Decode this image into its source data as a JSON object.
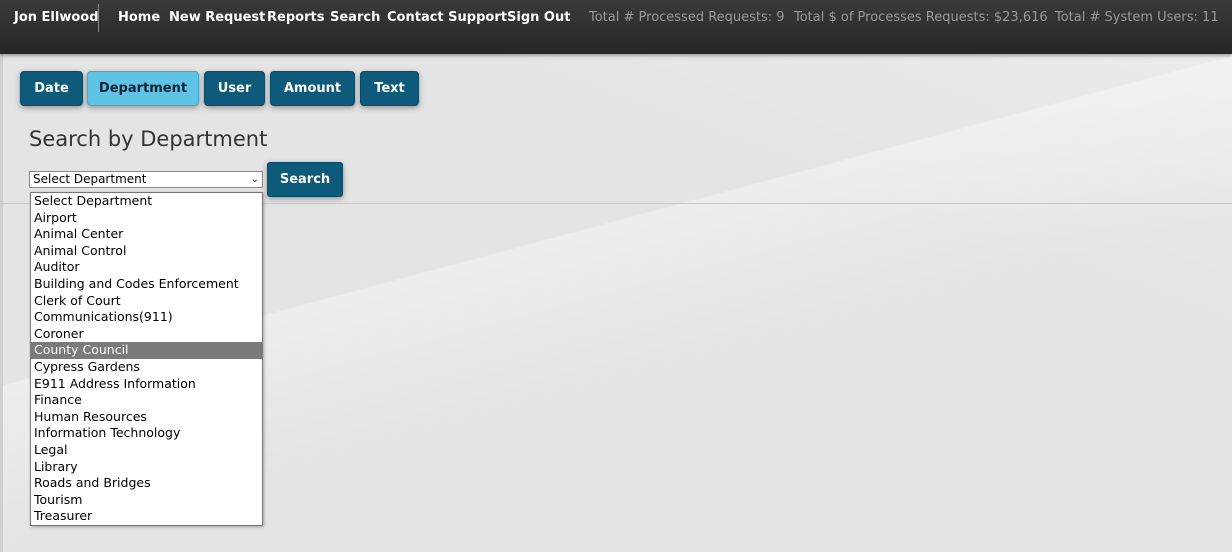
{
  "header": {
    "username": "Jon Ellwood",
    "nav": [
      "Home",
      "New Request",
      "Reports",
      "Search",
      "Contact Support",
      "Sign Out"
    ],
    "stats": [
      "Total # Processed Requests: 9",
      "Total $ of Processes Requests: $23,616",
      "Total # System Users: 11"
    ]
  },
  "tabs": [
    {
      "label": "Date",
      "active": false
    },
    {
      "label": "Department",
      "active": true
    },
    {
      "label": "User",
      "active": false
    },
    {
      "label": "Amount",
      "active": false
    },
    {
      "label": "Text",
      "active": false
    }
  ],
  "main": {
    "heading": "Search by Department",
    "select_value": "Select Department",
    "search_label": "Search"
  },
  "dropdown": {
    "highlighted_index": 9,
    "options": [
      "Select Department",
      "Airport",
      "Animal Center",
      "Animal Control",
      "Auditor",
      "Building and Codes Enforcement",
      "Clerk of Court",
      "Communications(911)",
      "Coroner",
      "County Council",
      "Cypress Gardens",
      "E911 Address Information",
      "Finance",
      "Human Resources",
      "Information Technology",
      "Legal",
      "Library",
      "Roads and Bridges",
      "Tourism",
      "Treasurer"
    ]
  },
  "colors": {
    "tab": "#0e5a7a",
    "tab_active": "#5fc3e6",
    "topbar": "#2e2e2e",
    "highlight": "#7a7a7a"
  }
}
